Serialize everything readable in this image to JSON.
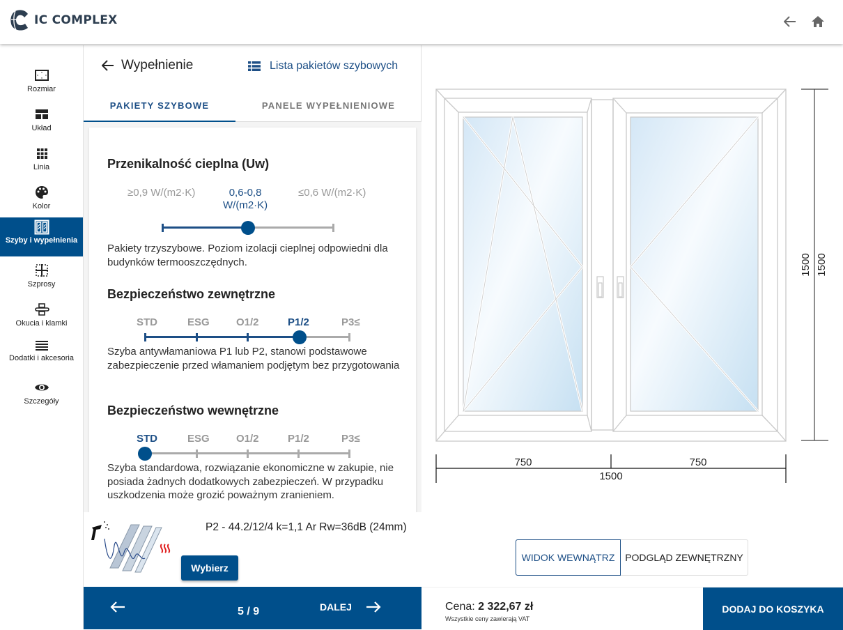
{
  "header": {
    "brand": "IC COMPLEX",
    "back_icon": "arrow-left-icon",
    "home_icon": "home-icon"
  },
  "sidebar": {
    "items": [
      {
        "label": "Rozmiar",
        "icon": "resize-icon",
        "active": false
      },
      {
        "label": "Układ",
        "icon": "layout-icon",
        "active": false
      },
      {
        "label": "Linia",
        "icon": "grid-icon",
        "active": false
      },
      {
        "label": "Kolor",
        "icon": "palette-icon",
        "active": false
      },
      {
        "label": "Szyby i wypełnienia",
        "icon": "glazing-icon",
        "active": true
      },
      {
        "label": "Szprosy",
        "icon": "muntins-icon",
        "active": false
      },
      {
        "label": "Okucia i klamki",
        "icon": "handle-icon",
        "active": false
      },
      {
        "label": "Dodatki i akcesoria",
        "icon": "menu-icon",
        "active": false
      },
      {
        "label": "Szczegóły",
        "icon": "eye-icon",
        "active": false
      }
    ]
  },
  "panel": {
    "title": "Wypełnienie",
    "list_link": "Lista pakietów szybowych",
    "tabs": [
      {
        "label": "PAKIETY SZYBOWE",
        "active": true
      },
      {
        "label": "PANELE WYPEŁNIENIOWE",
        "active": false
      }
    ],
    "thermal": {
      "title": "Przenikalność cieplna (Uw)",
      "options": [
        "≥0,9 W/(m2·K)",
        "0,6-0,8 W/(m2·K)",
        "≤0,6 W/(m2·K)"
      ],
      "selected_line1": "0,6-0,8",
      "selected_line2": "W/(m2·K)",
      "selected_index": 1,
      "description": "Pakiety trzyszybowe. Poziom izolacji cieplnej odpowiedni dla budynków termooszczędnych."
    },
    "security_ext": {
      "title": "Bezpieczeństwo zewnętrzne",
      "options": [
        "STD",
        "ESG",
        "O1/2",
        "P1/2",
        "P3≤"
      ],
      "selected_index": 3,
      "description": "Szyba antywłamaniowa P1 lub P2, stanowi podstawowe zabezpieczenie przed włamaniem podjętym bez przygotowania"
    },
    "security_int": {
      "title": "Bezpieczeństwo wewnętrzne",
      "options": [
        "STD",
        "ESG",
        "O1/2",
        "P1/2",
        "P3≤"
      ],
      "selected_index": 0,
      "description": "Szyba standardowa, rozwiązanie ekonomiczne w zakupie, nie posiada żadnych dodatkowych zabezpieczeń. W przypadku uszkodzenia może grozić poważnym zranieniem."
    },
    "product": {
      "name": "P2 - 44.2/12/4 k=1,1 Ar Rw=36dB (24mm)",
      "choose_label": "Wybierz"
    }
  },
  "stepper": {
    "current": "5 / 9",
    "next_label": "DALEJ"
  },
  "preview": {
    "dimensions": {
      "width_total": "1500",
      "width_left": "750",
      "width_right": "750",
      "height_outer": "1500",
      "height_inner": "1500"
    },
    "view_buttons": [
      {
        "label": "WIDOK WEWNĄTRZ",
        "active": true
      },
      {
        "label": "PODGLĄD ZEWNĘTRZNY",
        "active": false
      }
    ]
  },
  "footer": {
    "price_label": "Cena:",
    "price_value": "2 322,67 zł",
    "vat_note": "Wszystkie ceny zawierają VAT",
    "cart_label": "DODAJ DO KOSZYKA"
  },
  "colors": {
    "primary": "#004f8b",
    "link": "#1d4f86",
    "inactive": "#999999"
  }
}
